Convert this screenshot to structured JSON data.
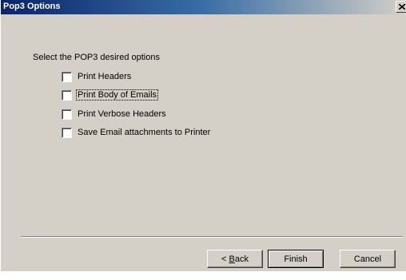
{
  "window": {
    "title": "Pop3 Options",
    "close_glyph": "✕"
  },
  "main": {
    "prompt": "Select the POP3 desired options",
    "options": [
      {
        "label": "Print Headers",
        "checked": false,
        "focused": false
      },
      {
        "label": "Print Body of Emails",
        "checked": false,
        "focused": true
      },
      {
        "label": "Print Verbose Headers",
        "checked": false,
        "focused": false
      },
      {
        "label": "Save Email attachments to Printer",
        "checked": false,
        "focused": false
      }
    ]
  },
  "footer": {
    "back_prefix": "< ",
    "back_accel": "B",
    "back_rest": "ack",
    "finish_label": "Finish",
    "cancel_label": "Cancel"
  },
  "colors": {
    "dialog_bg": "#d4d0c8",
    "titlebar_start": "#0a246a",
    "titlebar_end": "#d4d0c8"
  }
}
